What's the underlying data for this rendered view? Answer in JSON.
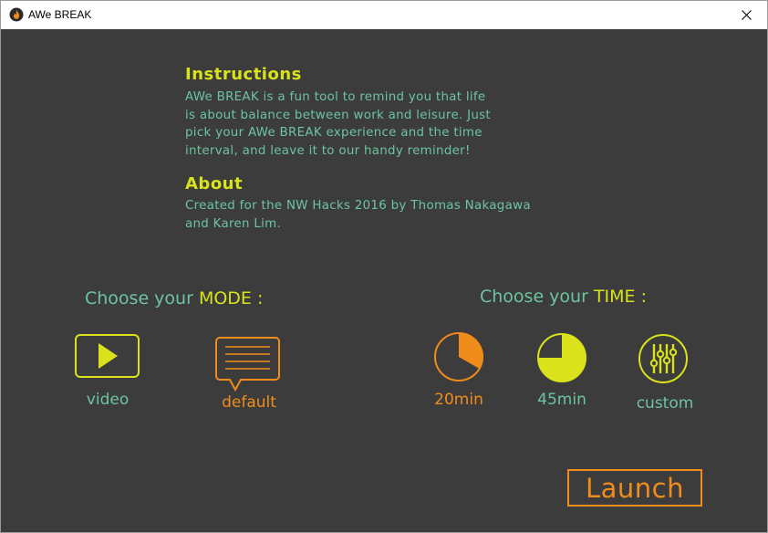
{
  "window": {
    "title": "AWe BREAK"
  },
  "instructions": {
    "heading": "Instructions",
    "lines": [
      "AWe BREAK is a fun tool to remind you that life",
      "is about balance between work and leisure. Just",
      "pick your AWe BREAK experience and the time",
      "interval, and leave it to our handy reminder!"
    ]
  },
  "about": {
    "heading": "About",
    "lines": [
      "Created for the NW Hacks 2016 by Thomas Nakagawa",
      "and Karen Lim."
    ]
  },
  "mode": {
    "title_prefix": "Choose your ",
    "title_highlight": "MODE :",
    "options": [
      {
        "label": "video",
        "icon": "play-icon",
        "selected": false
      },
      {
        "label": "default",
        "icon": "message-icon",
        "selected": true
      }
    ]
  },
  "time": {
    "title_prefix": "Choose your ",
    "title_highlight": "TIME :",
    "options": [
      {
        "label": "20min",
        "icon": "clock-20-icon",
        "fraction": 0.333,
        "selected": true
      },
      {
        "label": "45min",
        "icon": "clock-45-icon",
        "fraction": 0.75,
        "selected": false
      },
      {
        "label": "custom",
        "icon": "sliders-icon",
        "selected": false
      }
    ]
  },
  "launch_label": "Launch",
  "colors": {
    "background": "#3c3c3c",
    "heading": "#d9e21a",
    "text": "#6cc4a0",
    "accent": "#f08c1c"
  }
}
